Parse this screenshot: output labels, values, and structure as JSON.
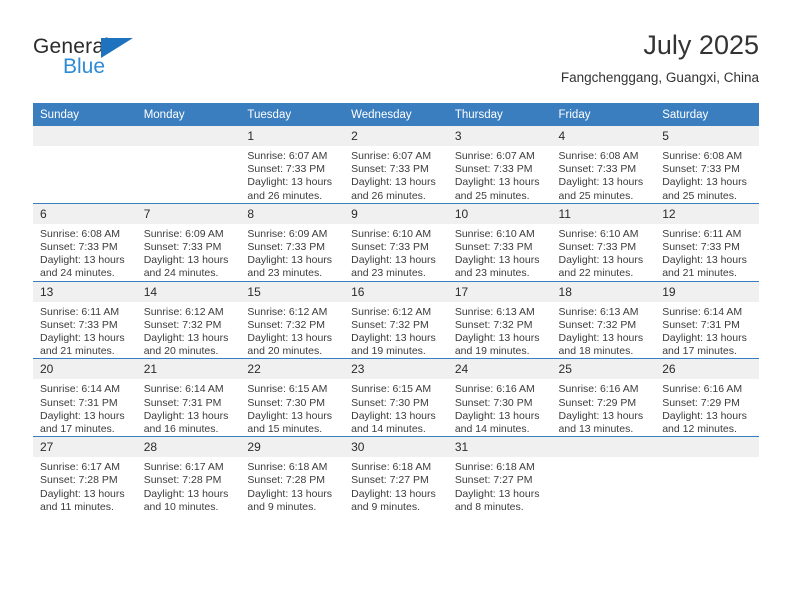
{
  "brand": {
    "name_primary": "General",
    "name_secondary": "Blue",
    "triangle_color": "#1f72bd",
    "secondary_color": "#2e8bd4"
  },
  "header": {
    "title": "July 2025",
    "subtitle": "Fangchenggang, Guangxi, China"
  },
  "theme": {
    "header_row_bg": "#3a7ebf",
    "daynum_bg": "#f0f0f0",
    "row_divider": "#3a7ebf"
  },
  "calendar": {
    "weekday_headers": [
      "Sunday",
      "Monday",
      "Tuesday",
      "Wednesday",
      "Thursday",
      "Friday",
      "Saturday"
    ],
    "weeks": [
      [
        {
          "day": "",
          "sunrise": "",
          "sunset": "",
          "daylight_1": "",
          "daylight_2": ""
        },
        {
          "day": "",
          "sunrise": "",
          "sunset": "",
          "daylight_1": "",
          "daylight_2": ""
        },
        {
          "day": "1",
          "sunrise": "Sunrise: 6:07 AM",
          "sunset": "Sunset: 7:33 PM",
          "daylight_1": "Daylight: 13 hours",
          "daylight_2": "and 26 minutes."
        },
        {
          "day": "2",
          "sunrise": "Sunrise: 6:07 AM",
          "sunset": "Sunset: 7:33 PM",
          "daylight_1": "Daylight: 13 hours",
          "daylight_2": "and 26 minutes."
        },
        {
          "day": "3",
          "sunrise": "Sunrise: 6:07 AM",
          "sunset": "Sunset: 7:33 PM",
          "daylight_1": "Daylight: 13 hours",
          "daylight_2": "and 25 minutes."
        },
        {
          "day": "4",
          "sunrise": "Sunrise: 6:08 AM",
          "sunset": "Sunset: 7:33 PM",
          "daylight_1": "Daylight: 13 hours",
          "daylight_2": "and 25 minutes."
        },
        {
          "day": "5",
          "sunrise": "Sunrise: 6:08 AM",
          "sunset": "Sunset: 7:33 PM",
          "daylight_1": "Daylight: 13 hours",
          "daylight_2": "and 25 minutes."
        }
      ],
      [
        {
          "day": "6",
          "sunrise": "Sunrise: 6:08 AM",
          "sunset": "Sunset: 7:33 PM",
          "daylight_1": "Daylight: 13 hours",
          "daylight_2": "and 24 minutes."
        },
        {
          "day": "7",
          "sunrise": "Sunrise: 6:09 AM",
          "sunset": "Sunset: 7:33 PM",
          "daylight_1": "Daylight: 13 hours",
          "daylight_2": "and 24 minutes."
        },
        {
          "day": "8",
          "sunrise": "Sunrise: 6:09 AM",
          "sunset": "Sunset: 7:33 PM",
          "daylight_1": "Daylight: 13 hours",
          "daylight_2": "and 23 minutes."
        },
        {
          "day": "9",
          "sunrise": "Sunrise: 6:10 AM",
          "sunset": "Sunset: 7:33 PM",
          "daylight_1": "Daylight: 13 hours",
          "daylight_2": "and 23 minutes."
        },
        {
          "day": "10",
          "sunrise": "Sunrise: 6:10 AM",
          "sunset": "Sunset: 7:33 PM",
          "daylight_1": "Daylight: 13 hours",
          "daylight_2": "and 23 minutes."
        },
        {
          "day": "11",
          "sunrise": "Sunrise: 6:10 AM",
          "sunset": "Sunset: 7:33 PM",
          "daylight_1": "Daylight: 13 hours",
          "daylight_2": "and 22 minutes."
        },
        {
          "day": "12",
          "sunrise": "Sunrise: 6:11 AM",
          "sunset": "Sunset: 7:33 PM",
          "daylight_1": "Daylight: 13 hours",
          "daylight_2": "and 21 minutes."
        }
      ],
      [
        {
          "day": "13",
          "sunrise": "Sunrise: 6:11 AM",
          "sunset": "Sunset: 7:33 PM",
          "daylight_1": "Daylight: 13 hours",
          "daylight_2": "and 21 minutes."
        },
        {
          "day": "14",
          "sunrise": "Sunrise: 6:12 AM",
          "sunset": "Sunset: 7:32 PM",
          "daylight_1": "Daylight: 13 hours",
          "daylight_2": "and 20 minutes."
        },
        {
          "day": "15",
          "sunrise": "Sunrise: 6:12 AM",
          "sunset": "Sunset: 7:32 PM",
          "daylight_1": "Daylight: 13 hours",
          "daylight_2": "and 20 minutes."
        },
        {
          "day": "16",
          "sunrise": "Sunrise: 6:12 AM",
          "sunset": "Sunset: 7:32 PM",
          "daylight_1": "Daylight: 13 hours",
          "daylight_2": "and 19 minutes."
        },
        {
          "day": "17",
          "sunrise": "Sunrise: 6:13 AM",
          "sunset": "Sunset: 7:32 PM",
          "daylight_1": "Daylight: 13 hours",
          "daylight_2": "and 19 minutes."
        },
        {
          "day": "18",
          "sunrise": "Sunrise: 6:13 AM",
          "sunset": "Sunset: 7:32 PM",
          "daylight_1": "Daylight: 13 hours",
          "daylight_2": "and 18 minutes."
        },
        {
          "day": "19",
          "sunrise": "Sunrise: 6:14 AM",
          "sunset": "Sunset: 7:31 PM",
          "daylight_1": "Daylight: 13 hours",
          "daylight_2": "and 17 minutes."
        }
      ],
      [
        {
          "day": "20",
          "sunrise": "Sunrise: 6:14 AM",
          "sunset": "Sunset: 7:31 PM",
          "daylight_1": "Daylight: 13 hours",
          "daylight_2": "and 17 minutes."
        },
        {
          "day": "21",
          "sunrise": "Sunrise: 6:14 AM",
          "sunset": "Sunset: 7:31 PM",
          "daylight_1": "Daylight: 13 hours",
          "daylight_2": "and 16 minutes."
        },
        {
          "day": "22",
          "sunrise": "Sunrise: 6:15 AM",
          "sunset": "Sunset: 7:30 PM",
          "daylight_1": "Daylight: 13 hours",
          "daylight_2": "and 15 minutes."
        },
        {
          "day": "23",
          "sunrise": "Sunrise: 6:15 AM",
          "sunset": "Sunset: 7:30 PM",
          "daylight_1": "Daylight: 13 hours",
          "daylight_2": "and 14 minutes."
        },
        {
          "day": "24",
          "sunrise": "Sunrise: 6:16 AM",
          "sunset": "Sunset: 7:30 PM",
          "daylight_1": "Daylight: 13 hours",
          "daylight_2": "and 14 minutes."
        },
        {
          "day": "25",
          "sunrise": "Sunrise: 6:16 AM",
          "sunset": "Sunset: 7:29 PM",
          "daylight_1": "Daylight: 13 hours",
          "daylight_2": "and 13 minutes."
        },
        {
          "day": "26",
          "sunrise": "Sunrise: 6:16 AM",
          "sunset": "Sunset: 7:29 PM",
          "daylight_1": "Daylight: 13 hours",
          "daylight_2": "and 12 minutes."
        }
      ],
      [
        {
          "day": "27",
          "sunrise": "Sunrise: 6:17 AM",
          "sunset": "Sunset: 7:28 PM",
          "daylight_1": "Daylight: 13 hours",
          "daylight_2": "and 11 minutes."
        },
        {
          "day": "28",
          "sunrise": "Sunrise: 6:17 AM",
          "sunset": "Sunset: 7:28 PM",
          "daylight_1": "Daylight: 13 hours",
          "daylight_2": "and 10 minutes."
        },
        {
          "day": "29",
          "sunrise": "Sunrise: 6:18 AM",
          "sunset": "Sunset: 7:28 PM",
          "daylight_1": "Daylight: 13 hours",
          "daylight_2": "and 9 minutes."
        },
        {
          "day": "30",
          "sunrise": "Sunrise: 6:18 AM",
          "sunset": "Sunset: 7:27 PM",
          "daylight_1": "Daylight: 13 hours",
          "daylight_2": "and 9 minutes."
        },
        {
          "day": "31",
          "sunrise": "Sunrise: 6:18 AM",
          "sunset": "Sunset: 7:27 PM",
          "daylight_1": "Daylight: 13 hours",
          "daylight_2": "and 8 minutes."
        },
        {
          "day": "",
          "sunrise": "",
          "sunset": "",
          "daylight_1": "",
          "daylight_2": ""
        },
        {
          "day": "",
          "sunrise": "",
          "sunset": "",
          "daylight_1": "",
          "daylight_2": ""
        }
      ]
    ]
  }
}
